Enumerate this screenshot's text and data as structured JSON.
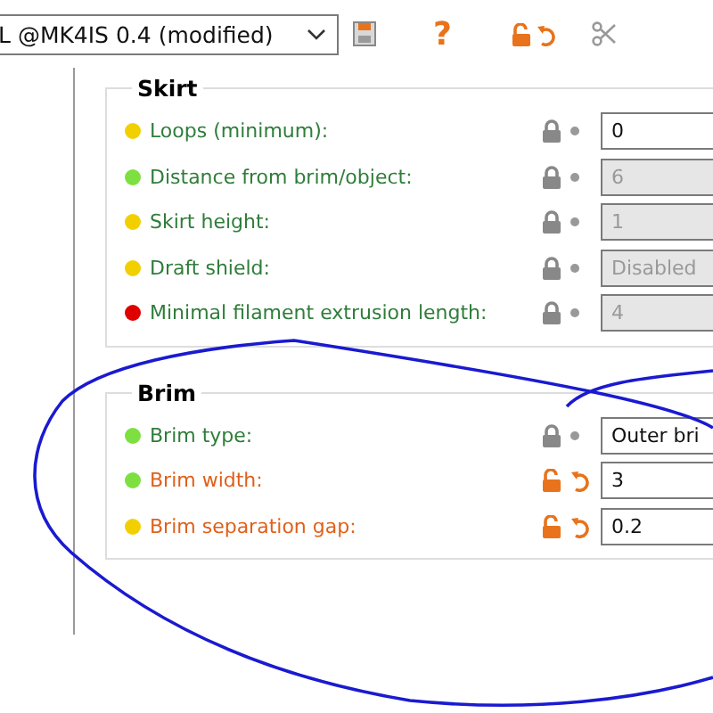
{
  "preset_combo": {
    "value": "L @MK4IS 0.4 (modified)"
  },
  "toolbar": {
    "help": "?"
  },
  "groups": [
    {
      "title": "Skirt",
      "rows": [
        {
          "label": "Loops (minimum):",
          "color": "#f2d000",
          "modified": false,
          "disabled": false,
          "value": "0"
        },
        {
          "label": "Distance from brim/object:",
          "color": "#7ee040",
          "modified": false,
          "disabled": true,
          "value": "6"
        },
        {
          "label": "Skirt height:",
          "color": "#f2d000",
          "modified": false,
          "disabled": true,
          "value": "1"
        },
        {
          "label": "Draft shield:",
          "color": "#f2d000",
          "modified": false,
          "disabled": true,
          "value": "Disabled"
        },
        {
          "label": "Minimal filament extrusion length:",
          "color": "#e00000",
          "modified": false,
          "disabled": true,
          "value": "4"
        }
      ]
    },
    {
      "title": "Brim",
      "rows": [
        {
          "label": "Brim type:",
          "color": "#7ee040",
          "modified": false,
          "disabled": false,
          "value": "Outer bri"
        },
        {
          "label": "Brim width:",
          "color": "#7ee040",
          "modified": true,
          "disabled": false,
          "value": "3"
        },
        {
          "label": "Brim separation gap:",
          "color": "#f2d000",
          "modified": true,
          "disabled": false,
          "value": "0.2"
        }
      ]
    }
  ]
}
